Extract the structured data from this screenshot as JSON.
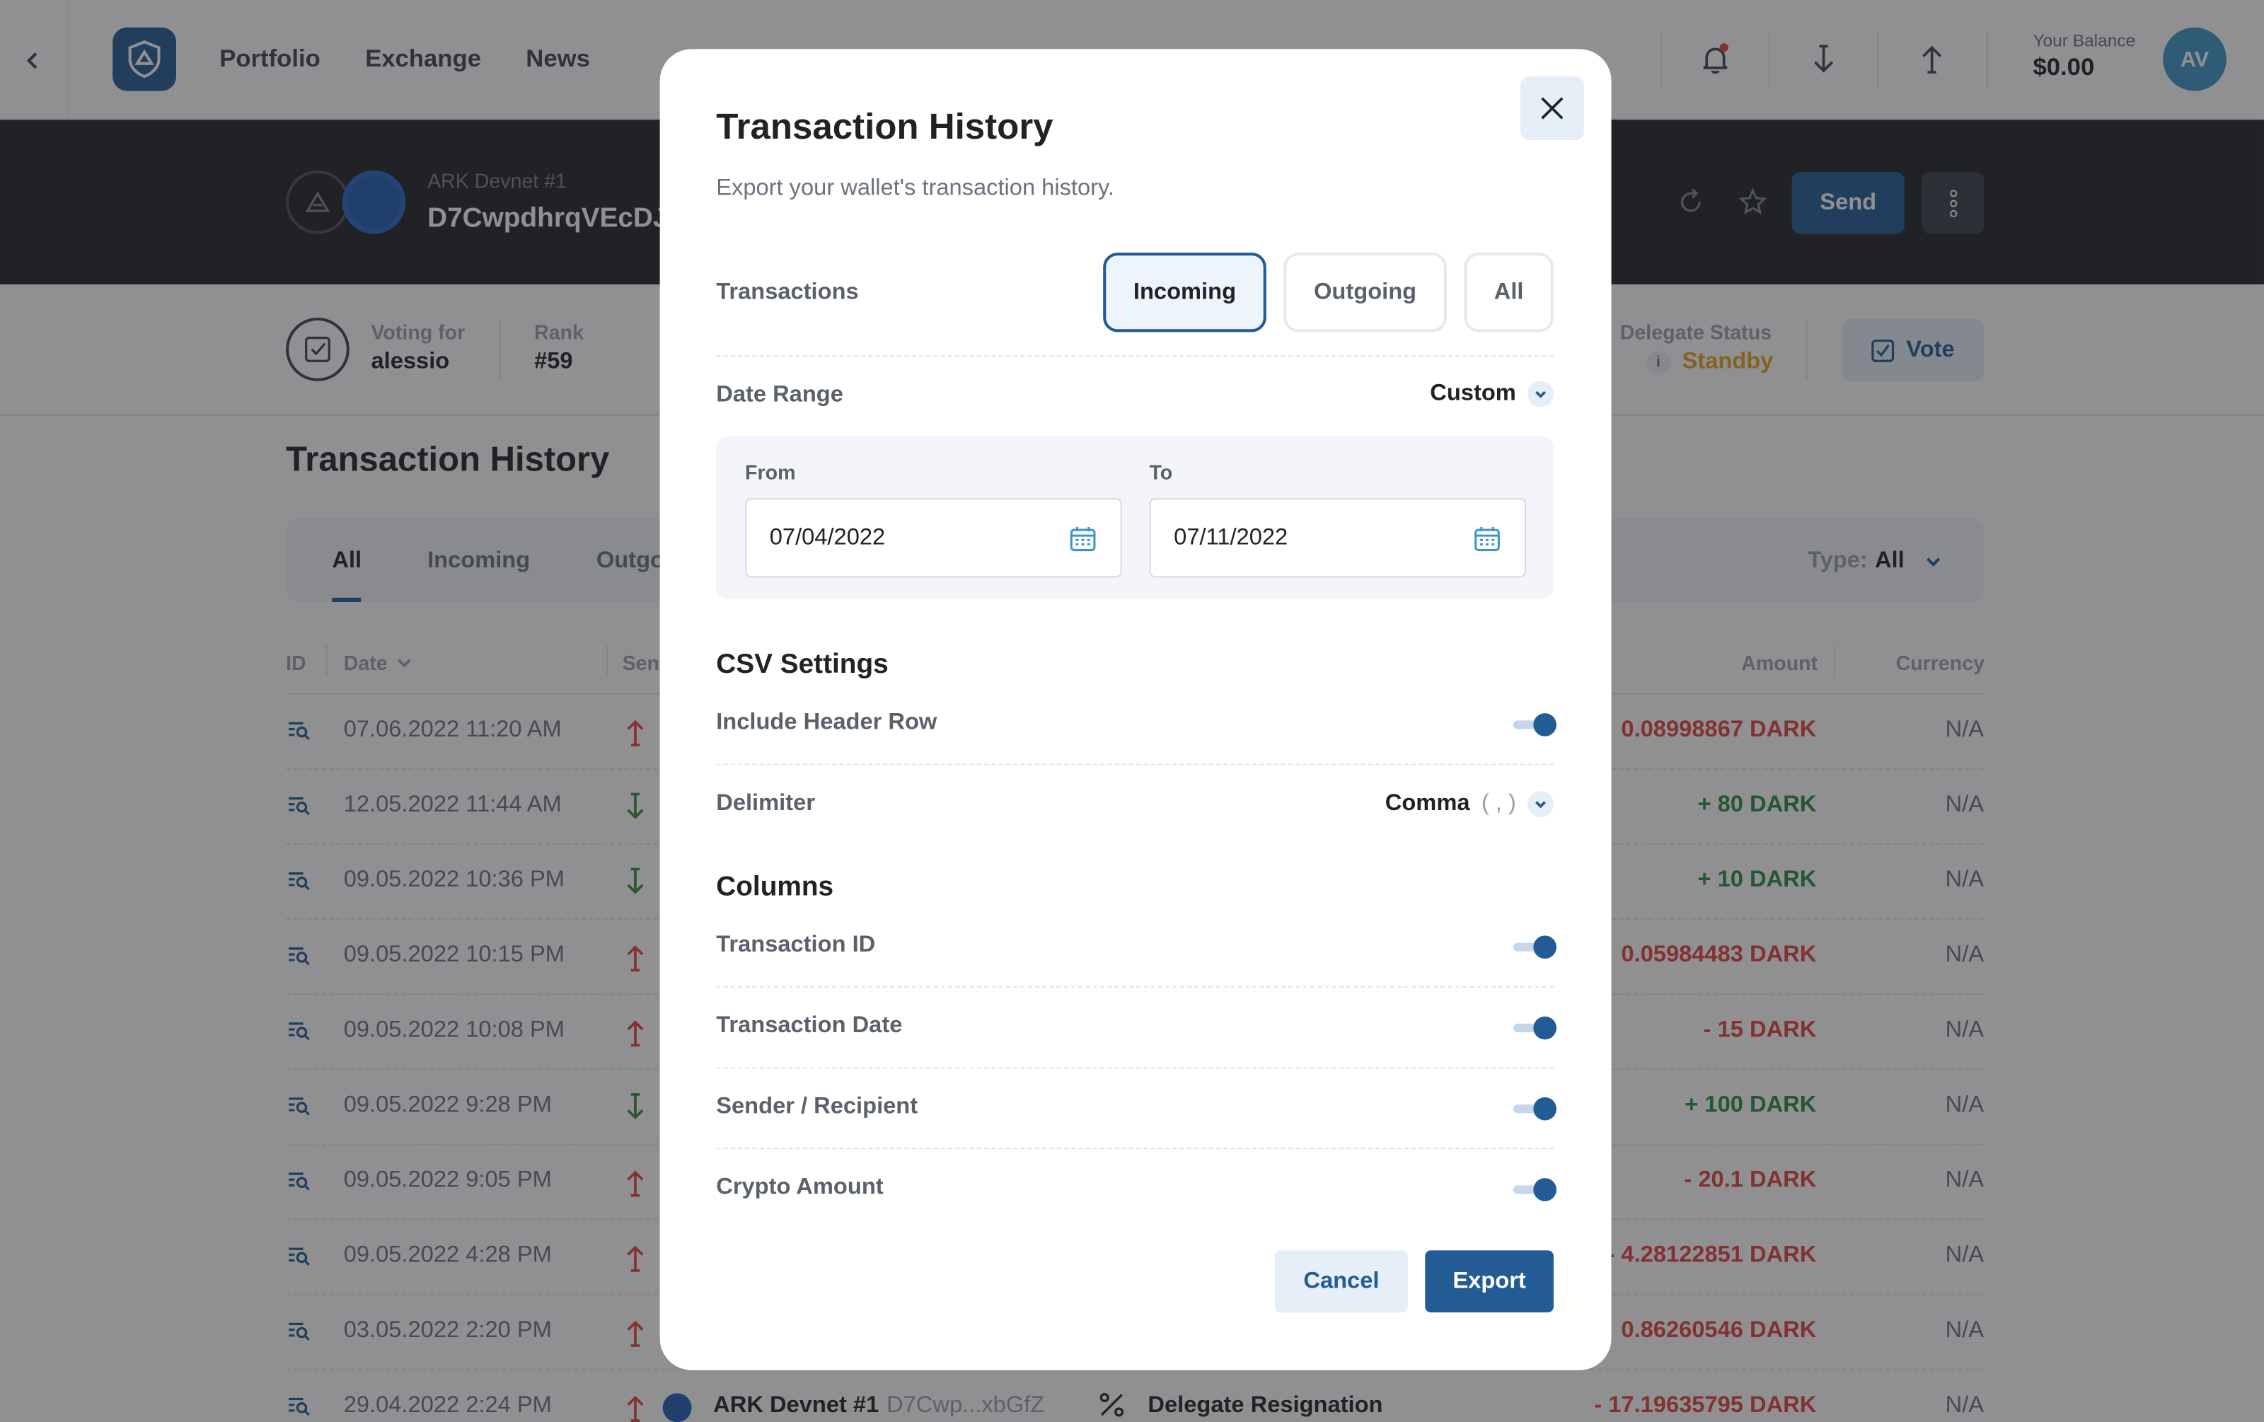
{
  "topbar": {
    "nav": [
      "Portfolio",
      "Exchange",
      "News"
    ],
    "balance_label": "Your Balance",
    "balance_value": "$0.00",
    "avatar": "AV"
  },
  "wallet": {
    "name": "ARK Devnet #1",
    "address": "D7CwpdhrqVEcDJ",
    "send_label": "Send",
    "voting_label": "Voting for",
    "voting_value": "alessio",
    "rank_label": "Rank",
    "rank_value": "#59",
    "delegate_label": "Delegate Status",
    "delegate_value": "Standby",
    "vote_label": "Vote"
  },
  "history": {
    "title": "Transaction History",
    "tabs": [
      "All",
      "Incoming",
      "Outgo"
    ],
    "type_label": "Type:",
    "type_value": "All",
    "headers": {
      "id": "ID",
      "date": "Date",
      "sender": "Sen",
      "amount": "Amount",
      "currency": "Currency"
    },
    "rows": [
      {
        "date": "07.06.2022 11:20 AM",
        "dir": "out",
        "amount": "0.08998867 DARK",
        "currency": "N/A"
      },
      {
        "date": "12.05.2022 11:44 AM",
        "dir": "in",
        "amount": "+ 80 DARK",
        "currency": "N/A"
      },
      {
        "date": "09.05.2022 10:36 PM",
        "dir": "in",
        "amount": "+ 10 DARK",
        "currency": "N/A"
      },
      {
        "date": "09.05.2022 10:15 PM",
        "dir": "out",
        "amount": "0.05984483 DARK",
        "currency": "N/A"
      },
      {
        "date": "09.05.2022 10:08 PM",
        "dir": "out",
        "amount": "- 15 DARK",
        "currency": "N/A"
      },
      {
        "date": "09.05.2022 9:28 PM",
        "dir": "in",
        "amount": "+ 100 DARK",
        "currency": "N/A"
      },
      {
        "date": "09.05.2022 9:05 PM",
        "dir": "out",
        "amount": "- 20.1 DARK",
        "currency": "N/A"
      },
      {
        "date": "09.05.2022 4:28 PM",
        "dir": "out",
        "amount": "- 4.28122851 DARK",
        "currency": "N/A"
      },
      {
        "date": "03.05.2022 2:20 PM",
        "dir": "out",
        "amount": "0.86260546 DARK",
        "currency": "N/A"
      },
      {
        "date": "29.04.2022 2:24 PM",
        "dir": "out",
        "amount": "- 17.19635795 DARK",
        "currency": "N/A"
      }
    ],
    "last_row_wallet": "ARK Devnet #1",
    "last_row_addr": "D7Cwp...xbGfZ",
    "last_row_type": "Delegate Resignation"
  },
  "modal": {
    "title": "Transaction History",
    "subtitle": "Export your wallet's transaction history.",
    "transactions_label": "Transactions",
    "options": [
      "Incoming",
      "Outgoing",
      "All"
    ],
    "selected_option": "Incoming",
    "date_range_label": "Date Range",
    "date_range_value": "Custom",
    "from_label": "From",
    "from_value": "07/04/2022",
    "to_label": "To",
    "to_value": "07/11/2022",
    "csv_title": "CSV Settings",
    "include_header_label": "Include Header Row",
    "include_header_on": true,
    "delimiter_label": "Delimiter",
    "delimiter_value": "Comma",
    "delimiter_symbol": "( , )",
    "columns_title": "Columns",
    "columns": [
      {
        "label": "Transaction ID",
        "on": true
      },
      {
        "label": "Transaction Date",
        "on": true
      },
      {
        "label": "Sender / Recipient",
        "on": true
      },
      {
        "label": "Crypto Amount",
        "on": true
      }
    ],
    "cancel_label": "Cancel",
    "export_label": "Export"
  },
  "colors": {
    "primary": "#235b95",
    "negative": "#e0433c",
    "positive": "#2b8a3e",
    "warning": "#e9a21d"
  }
}
